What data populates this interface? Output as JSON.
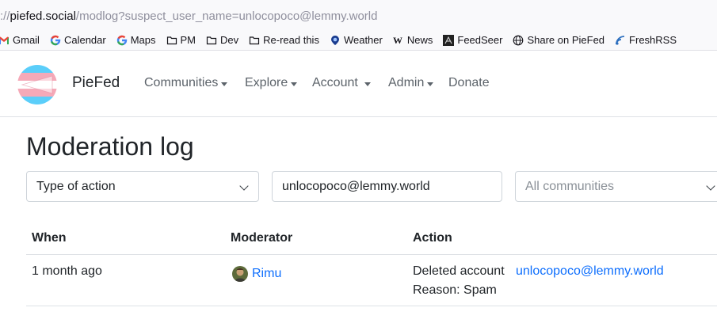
{
  "browser": {
    "url_prefix": "://",
    "url_host": "piefed.social",
    "url_path": "/modlog?suspect_user_name=unlocopoco@lemmy.world"
  },
  "bookmarks": [
    {
      "label": "Gmail",
      "icon": "gmail-icon"
    },
    {
      "label": "Calendar",
      "icon": "google-icon"
    },
    {
      "label": "Maps",
      "icon": "google-icon"
    },
    {
      "label": "PM",
      "icon": "folder-icon"
    },
    {
      "label": "Dev",
      "icon": "folder-icon"
    },
    {
      "label": "Re-read this",
      "icon": "folder-icon"
    },
    {
      "label": "Weather",
      "icon": "weather-icon"
    },
    {
      "label": "News",
      "icon": "wikipedia-icon"
    },
    {
      "label": "FeedSeer",
      "icon": "feedseer-icon"
    },
    {
      "label": "Share on PieFed",
      "icon": "globe-icon"
    },
    {
      "label": "FreshRSS",
      "icon": "freshrss-icon"
    }
  ],
  "navbar": {
    "brand": "PieFed",
    "items": [
      {
        "label": "Communities",
        "dropdown": true
      },
      {
        "label": "Explore",
        "dropdown": true
      },
      {
        "label": "Account",
        "dropdown": true
      },
      {
        "label": "Admin",
        "dropdown": true
      },
      {
        "label": "Donate",
        "dropdown": false
      }
    ]
  },
  "main": {
    "title": "Moderation log",
    "filters": {
      "action_type": "Type of action",
      "user_value": "unlocopoco@lemmy.world",
      "community_placeholder": "All communities"
    },
    "table": {
      "headers": [
        "When",
        "Moderator",
        "Action"
      ],
      "rows": [
        {
          "when": "1 month ago",
          "moderator": "Rimu",
          "action": "Deleted account",
          "target": "unlocopoco@lemmy.world",
          "reason": "Reason: Spam"
        }
      ]
    }
  },
  "colors": {
    "link": "#0d6efd",
    "nav_text": "#5c636a",
    "trans_blue": "#5bcefa",
    "trans_pink": "#f5a9b8"
  }
}
